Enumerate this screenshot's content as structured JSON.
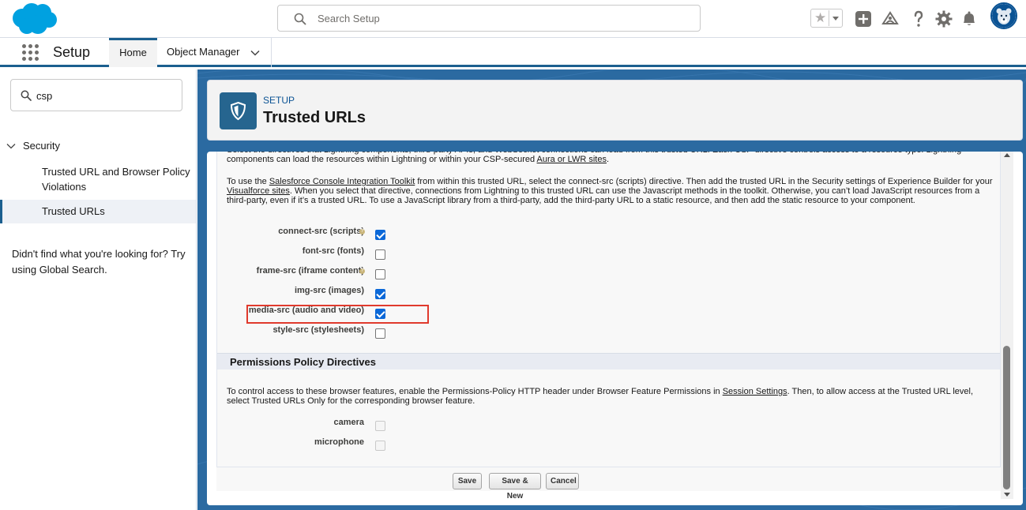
{
  "header": {
    "search_placeholder": "Search Setup"
  },
  "context_bar": {
    "app_name": "Setup",
    "tabs": [
      {
        "label": "Home",
        "active": true
      },
      {
        "label": "Object Manager",
        "active": false
      }
    ]
  },
  "sidebar": {
    "quick_find_value": "csp",
    "section": "Security",
    "items": [
      {
        "label": "Trusted URL and Browser Policy Violations",
        "selected": false
      },
      {
        "label": "Trusted URLs",
        "selected": true
      }
    ],
    "not_found_text": "Didn't find what you're looking for? Try using Global Search."
  },
  "page_header": {
    "eyebrow": "SETUP",
    "title": "Trusted URLs"
  },
  "content": {
    "para1_a": "Select the directives that Lightning components, third-party APIs, and WebSocket connections can load from this trusted URL. Each CSP directive controls access to a resource type. Lightning components can load the resources within Lightning or within your CSP-secured ",
    "para1_link": "Aura or LWR sites",
    "para1_b": ".",
    "para2_a": "To use the ",
    "para2_link1": "Salesforce Console Integration Toolkit",
    "para2_b": " from within this trusted URL, select the connect-src (scripts) directive. Then add the trusted URL in the Security settings of Experience Builder for your ",
    "para2_link2": "Visualforce sites",
    "para2_c": ". When you select that directive, connections from Lightning to this trusted URL can use the Javascript methods in the toolkit. Otherwise, you can’t load JavaScript resources from a third-party, even if it’s a trusted URL. To use a JavaScript library from a third-party, add the third-party URL to a static resource, and then add the static resource to your component.",
    "csp_directives": [
      {
        "label": "connect-src (scripts)",
        "checked": true,
        "help": true
      },
      {
        "label": "font-src (fonts)",
        "checked": false,
        "help": false
      },
      {
        "label": "frame-src (iframe content)",
        "checked": false,
        "help": true
      },
      {
        "label": "img-src (images)",
        "checked": true,
        "help": false
      },
      {
        "label": "media-src (audio and video)",
        "checked": true,
        "help": false
      },
      {
        "label": "style-src (stylesheets)",
        "checked": false,
        "help": false
      }
    ],
    "permissions_section_title": "Permissions Policy Directives",
    "para3_a": "To control access to these browser features, enable the Permissions-Policy HTTP header under Browser Feature Permissions in ",
    "para3_link": "Session Settings",
    "para3_b": ". Then, to allow access at the Trusted URL level, select Trusted URLs Only for the corresponding browser feature.",
    "permissions": [
      {
        "label": "camera",
        "checked": false,
        "disabled": true
      },
      {
        "label": "microphone",
        "checked": false,
        "disabled": true
      }
    ],
    "buttons": {
      "save": "Save",
      "save_new": "Save & New",
      "cancel": "Cancel"
    }
  },
  "colors": {
    "brand_blue": "#1b5f8f",
    "checkbox_blue": "#0b68d8",
    "highlight_red": "#e03a2d"
  }
}
